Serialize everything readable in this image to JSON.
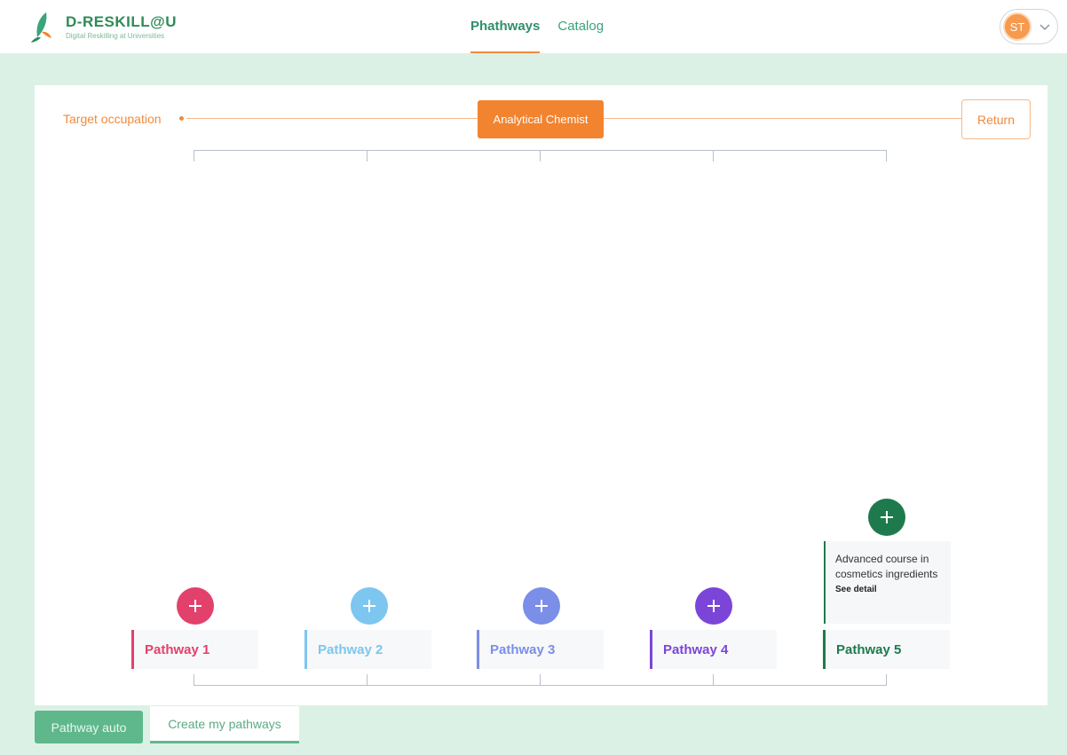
{
  "header": {
    "logo_title": "D-RESKILL@U",
    "logo_subtitle": "Digital Reskilling at Universities",
    "nav": [
      {
        "label": "Phathways",
        "active": true
      },
      {
        "label": "Catalog",
        "active": false
      }
    ],
    "user_initials": "ST"
  },
  "target": {
    "label": "Target occupation",
    "occupation": "Analytical Chemist",
    "return_label": "Return"
  },
  "pathways": [
    {
      "label": "Pathway 1",
      "color": "#e2416c"
    },
    {
      "label": "Pathway 2",
      "color": "#7cc6ef"
    },
    {
      "label": "Pathway 3",
      "color": "#7b8ee8"
    },
    {
      "label": "Pathway 4",
      "color": "#7b45d8"
    },
    {
      "label": "Pathway 5",
      "color": "#1e7a4c"
    }
  ],
  "course": {
    "title": "Advanced course in cosmetics ingredients",
    "link": "See detail"
  },
  "tabs": {
    "auto": "Pathway auto",
    "create": "Create my pathways"
  },
  "colors": {
    "brand_green": "#2e8b57",
    "accent_orange": "#f2832f",
    "page_bg": "#dcf1e6"
  }
}
